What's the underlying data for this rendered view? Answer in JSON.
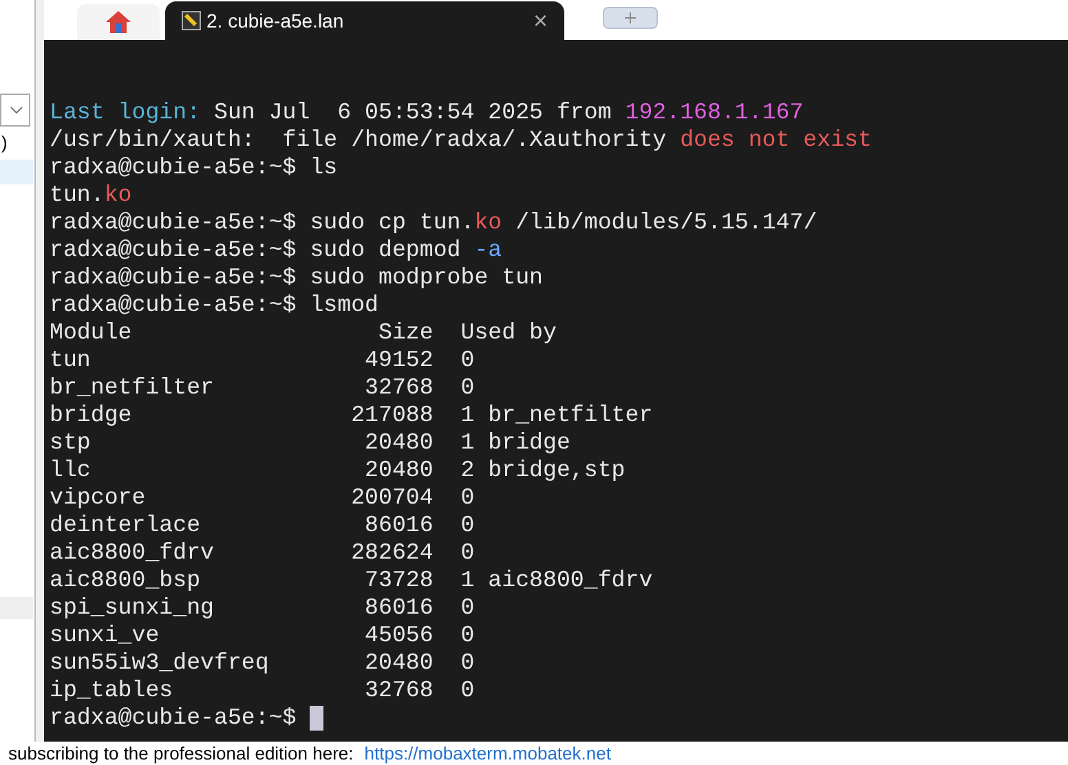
{
  "sidebar": {
    "row_text": ")"
  },
  "tabs": [
    {
      "kind": "home",
      "selected": false
    },
    {
      "kind": "session",
      "label": "2. cubie-a5e.lan",
      "close": "×",
      "selected": true
    },
    {
      "kind": "new",
      "selected": false
    }
  ],
  "terminal": {
    "lines": [
      [
        {
          "kind": "label",
          "text": "Last login:"
        },
        {
          "kind": "plain",
          "text": " Sun Jul  6 05:53:54 2025 from "
        },
        {
          "kind": "host",
          "text": "192.168.1.167"
        }
      ],
      [
        {
          "kind": "plain",
          "text": "/usr/bin/xauth:  file /home/radxa/.Xauthority "
        },
        {
          "kind": "error",
          "text": "does not exist"
        }
      ],
      [
        {
          "kind": "plain",
          "text": "radxa@cubie-a5e:~$ ls"
        }
      ],
      [
        {
          "kind": "plain",
          "text": "tun."
        },
        {
          "kind": "error",
          "text": "ko"
        }
      ],
      [
        {
          "kind": "plain",
          "text": "radxa@cubie-a5e:~$ sudo cp tun."
        },
        {
          "kind": "error",
          "text": "ko"
        },
        {
          "kind": "plain",
          "text": " /lib/modules/5.15.147/"
        }
      ],
      [
        {
          "kind": "plain",
          "text": "radxa@cubie-a5e:~$ sudo depmod "
        },
        {
          "kind": "option",
          "text": "-a"
        }
      ],
      [
        {
          "kind": "plain",
          "text": "radxa@cubie-a5e:~$ sudo modprobe tun"
        }
      ],
      [
        {
          "kind": "plain",
          "text": "radxa@cubie-a5e:~$ lsmod"
        }
      ],
      [
        {
          "kind": "plain",
          "text": "Module                  Size  Used by"
        }
      ],
      [
        {
          "kind": "plain",
          "text": "tun                    49152  0"
        }
      ],
      [
        {
          "kind": "plain",
          "text": "br_netfilter           32768  0"
        }
      ],
      [
        {
          "kind": "plain",
          "text": "bridge                217088  1 br_netfilter"
        }
      ],
      [
        {
          "kind": "plain",
          "text": "stp                    20480  1 bridge"
        }
      ],
      [
        {
          "kind": "plain",
          "text": "llc                    20480  2 bridge,stp"
        }
      ],
      [
        {
          "kind": "plain",
          "text": "vipcore               200704  0"
        }
      ],
      [
        {
          "kind": "plain",
          "text": "deinterlace            86016  0"
        }
      ],
      [
        {
          "kind": "plain",
          "text": "aic8800_fdrv          282624  0"
        }
      ],
      [
        {
          "kind": "plain",
          "text": "aic8800_bsp            73728  1 aic8800_fdrv"
        }
      ],
      [
        {
          "kind": "plain",
          "text": "spi_sunxi_ng           86016  0"
        }
      ],
      [
        {
          "kind": "plain",
          "text": "sunxi_ve               45056  0"
        }
      ],
      [
        {
          "kind": "plain",
          "text": "sun55iw3_devfreq       20480  0"
        }
      ],
      [
        {
          "kind": "plain",
          "text": "ip_tables              32768  0"
        }
      ],
      [
        {
          "kind": "plain",
          "text": "radxa@cubie-a5e:~$ "
        }
      ]
    ],
    "cursor": true
  },
  "status_bar": {
    "text": "subscribing to the professional edition here:",
    "link": "https://mobaxterm.mobatek.net"
  }
}
